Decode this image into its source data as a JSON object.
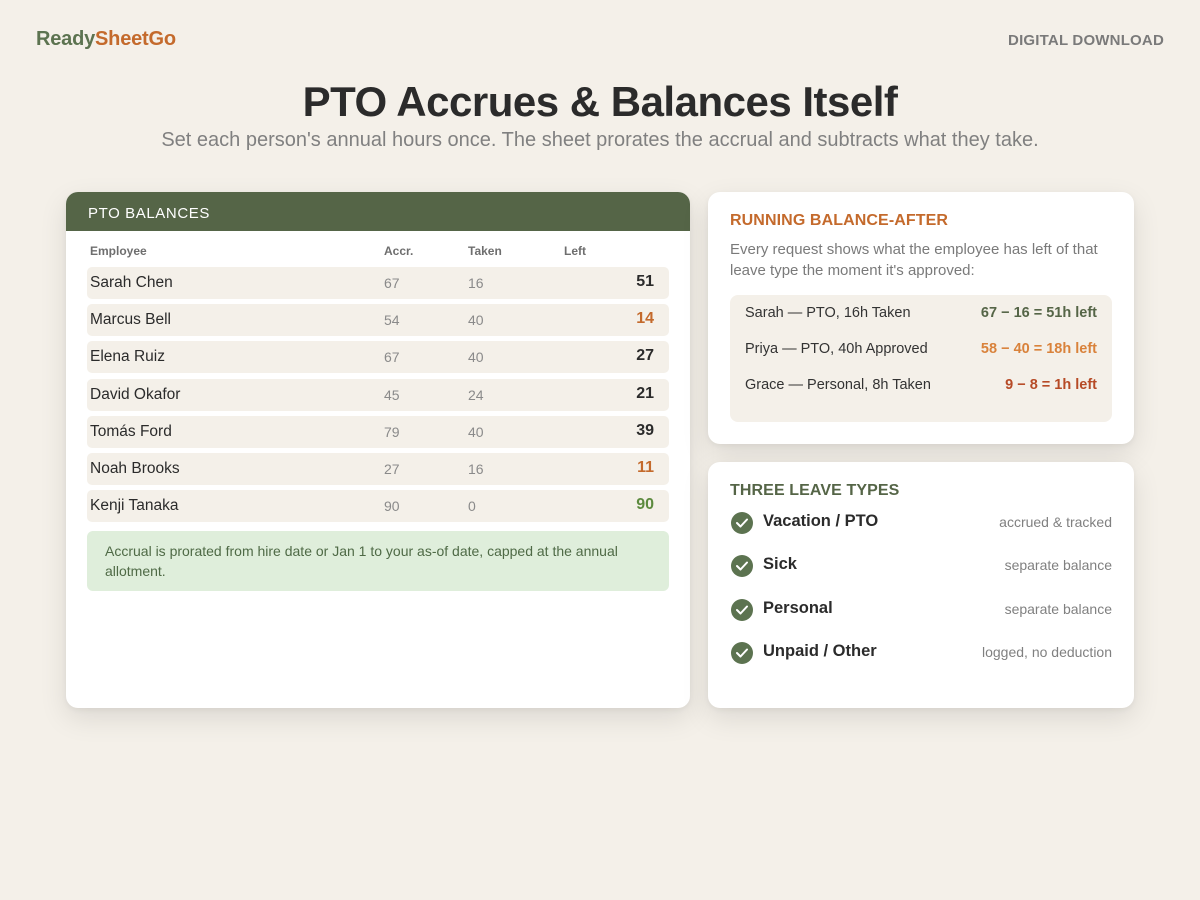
{
  "brand": {
    "part1": "Ready",
    "part2": "SheetGo"
  },
  "tag": "DIGITAL DOWNLOAD",
  "hero": {
    "title": "PTO Accrues & Balances Itself",
    "subtitle": "Set each person's annual hours once. The sheet prorates the accrual and subtracts what they take."
  },
  "balances": {
    "header": "PTO BALANCES",
    "columns": {
      "employee": "Employee",
      "accrued": "Accr.",
      "taken": "Taken",
      "left": "Left"
    },
    "rows": [
      {
        "name": "Sarah Chen",
        "accrued": "67",
        "taken": "16",
        "left": "51",
        "status": "normal"
      },
      {
        "name": "Marcus Bell",
        "accrued": "54",
        "taken": "40",
        "left": "14",
        "status": "low"
      },
      {
        "name": "Elena Ruiz",
        "accrued": "67",
        "taken": "40",
        "left": "27",
        "status": "normal"
      },
      {
        "name": "David Okafor",
        "accrued": "45",
        "taken": "24",
        "left": "21",
        "status": "normal"
      },
      {
        "name": "Tomás Ford",
        "accrued": "79",
        "taken": "40",
        "left": "39",
        "status": "normal"
      },
      {
        "name": "Noah Brooks",
        "accrued": "27",
        "taken": "16",
        "left": "11",
        "status": "low"
      },
      {
        "name": "Kenji Tanaka",
        "accrued": "90",
        "taken": "0",
        "left": "90",
        "status": "full"
      }
    ],
    "note": "Accrual is prorated from hire date or Jan 1 to your as-of date, capped at the annual allotment."
  },
  "running": {
    "title": "RUNNING BALANCE-AFTER",
    "description": "Every request shows what the employee has left of that leave type the moment it's approved:",
    "examples": [
      {
        "label": "Sarah — PTO, 16h Taken",
        "value": "67 − 16 = 51h left",
        "status": "ok"
      },
      {
        "label": "Priya — PTO, 40h Approved",
        "value": "58 − 40 = 18h left",
        "status": "warn"
      },
      {
        "label": "Grace — Personal, 8h Taken",
        "value": "9 − 8 = 1h left",
        "status": "critical"
      }
    ]
  },
  "leave_types": {
    "title": "THREE LEAVE TYPES",
    "items": [
      {
        "name": "Vacation / PTO",
        "note": "accrued & tracked",
        "icon": "check-circle-icon"
      },
      {
        "name": "Sick",
        "note": "separate balance",
        "icon": "check-circle-icon"
      },
      {
        "name": "Personal",
        "note": "separate balance",
        "icon": "check-circle-icon"
      },
      {
        "name": "Unpaid / Other",
        "note": "logged, no deduction",
        "icon": "check-circle-icon"
      }
    ]
  },
  "colors": {
    "normal": "#2b2b2b",
    "low": "#c46a2c",
    "full": "#5c8a3e",
    "ok": "#556547",
    "warn": "#d9823b",
    "critical": "#b64a26"
  }
}
